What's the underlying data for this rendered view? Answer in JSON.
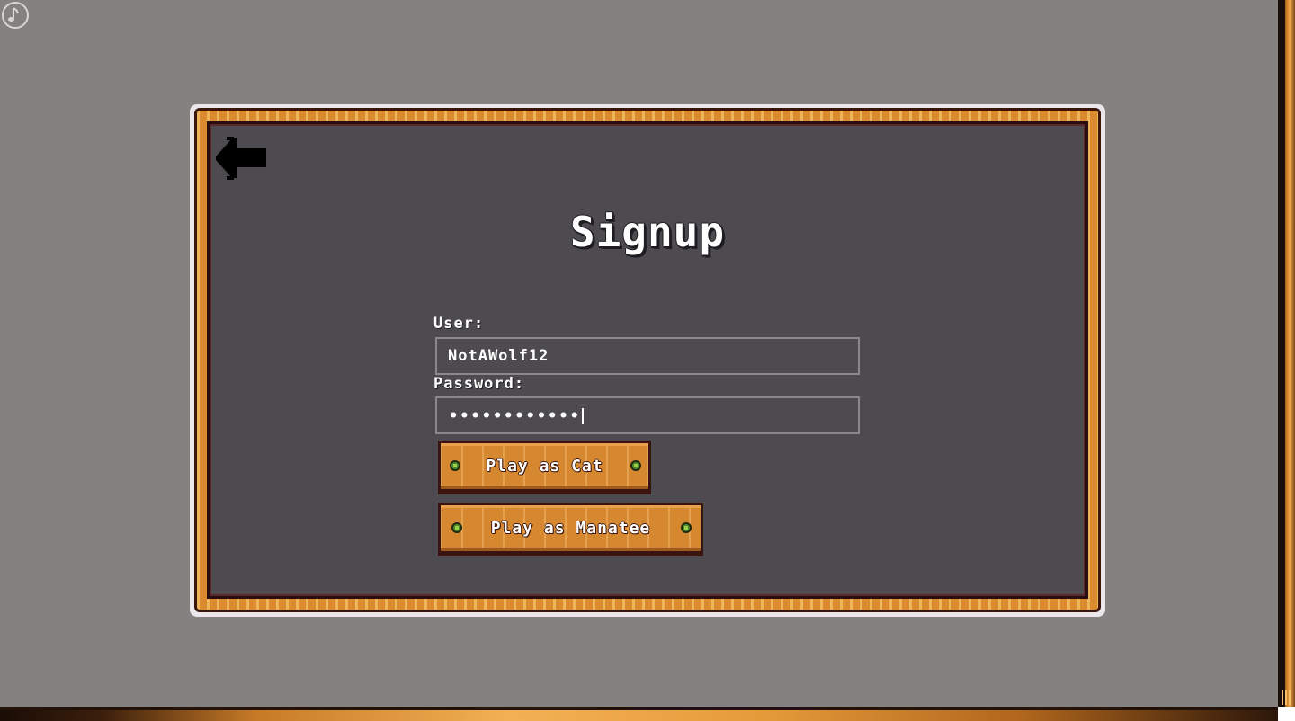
{
  "music": {
    "icon": "music-note-icon"
  },
  "back": {
    "icon": "back-arrow-icon"
  },
  "signup": {
    "title": "Signup",
    "user_label": "User:",
    "user_value": "NotAWolf12",
    "password_label": "Password:",
    "password_mask": "••••••••••••",
    "play_cat_label": "Play as Cat",
    "play_manatee_label": "Play as Manatee"
  },
  "colors": {
    "background": "#848281",
    "panel": "#4d4a50",
    "frame_wood": "#d98b2e",
    "frame_dark": "#3a1608",
    "bolt_green": "#4e8a2a",
    "text": "#ffffff"
  }
}
